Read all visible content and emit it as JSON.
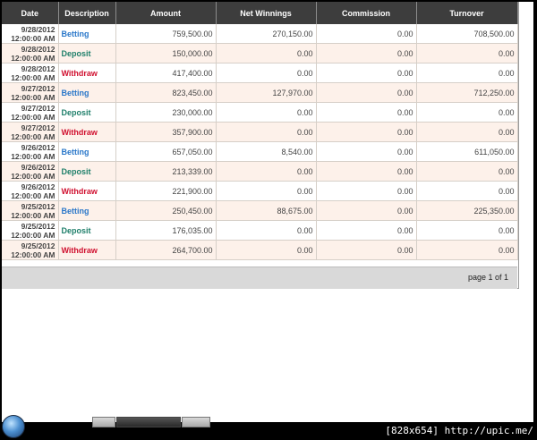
{
  "table": {
    "columns": [
      "Date",
      "Description",
      "Amount",
      "Net Winnings",
      "Commission",
      "Turnover"
    ],
    "rows": [
      {
        "date": "9/28/2012",
        "time": "12:00:00 AM",
        "description": "Betting",
        "amount": "759,500.00",
        "net_winnings": "270,150.00",
        "commission": "0.00",
        "turnover": "708,500.00"
      },
      {
        "date": "9/28/2012",
        "time": "12:00:00 AM",
        "description": "Deposit",
        "amount": "150,000.00",
        "net_winnings": "0.00",
        "commission": "0.00",
        "turnover": "0.00"
      },
      {
        "date": "9/28/2012",
        "time": "12:00:00 AM",
        "description": "Withdraw",
        "amount": "417,400.00",
        "net_winnings": "0.00",
        "commission": "0.00",
        "turnover": "0.00"
      },
      {
        "date": "9/27/2012",
        "time": "12:00:00 AM",
        "description": "Betting",
        "amount": "823,450.00",
        "net_winnings": "127,970.00",
        "commission": "0.00",
        "turnover": "712,250.00"
      },
      {
        "date": "9/27/2012",
        "time": "12:00:00 AM",
        "description": "Deposit",
        "amount": "230,000.00",
        "net_winnings": "0.00",
        "commission": "0.00",
        "turnover": "0.00"
      },
      {
        "date": "9/27/2012",
        "time": "12:00:00 AM",
        "description": "Withdraw",
        "amount": "357,900.00",
        "net_winnings": "0.00",
        "commission": "0.00",
        "turnover": "0.00"
      },
      {
        "date": "9/26/2012",
        "time": "12:00:00 AM",
        "description": "Betting",
        "amount": "657,050.00",
        "net_winnings": "8,540.00",
        "commission": "0.00",
        "turnover": "611,050.00"
      },
      {
        "date": "9/26/2012",
        "time": "12:00:00 AM",
        "description": "Deposit",
        "amount": "213,339.00",
        "net_winnings": "0.00",
        "commission": "0.00",
        "turnover": "0.00"
      },
      {
        "date": "9/26/2012",
        "time": "12:00:00 AM",
        "description": "Withdraw",
        "amount": "221,900.00",
        "net_winnings": "0.00",
        "commission": "0.00",
        "turnover": "0.00"
      },
      {
        "date": "9/25/2012",
        "time": "12:00:00 AM",
        "description": "Betting",
        "amount": "250,450.00",
        "net_winnings": "88,675.00",
        "commission": "0.00",
        "turnover": "225,350.00"
      },
      {
        "date": "9/25/2012",
        "time": "12:00:00 AM",
        "description": "Deposit",
        "amount": "176,035.00",
        "net_winnings": "0.00",
        "commission": "0.00",
        "turnover": "0.00"
      },
      {
        "date": "9/25/2012",
        "time": "12:00:00 AM",
        "description": "Withdraw",
        "amount": "264,700.00",
        "net_winnings": "0.00",
        "commission": "0.00",
        "turnover": "0.00"
      }
    ]
  },
  "pager": {
    "label": "page 1 of 1"
  },
  "watermark": {
    "text": "[828x654] http://upic.me/"
  },
  "colors": {
    "header_bg": "#3d3d3d",
    "row_alt_bg": "#fdf1ea",
    "betting": "#2a77c9",
    "deposit": "#1f7f6a",
    "withdraw": "#d0102f",
    "pager_bg": "#d9d9d9"
  }
}
